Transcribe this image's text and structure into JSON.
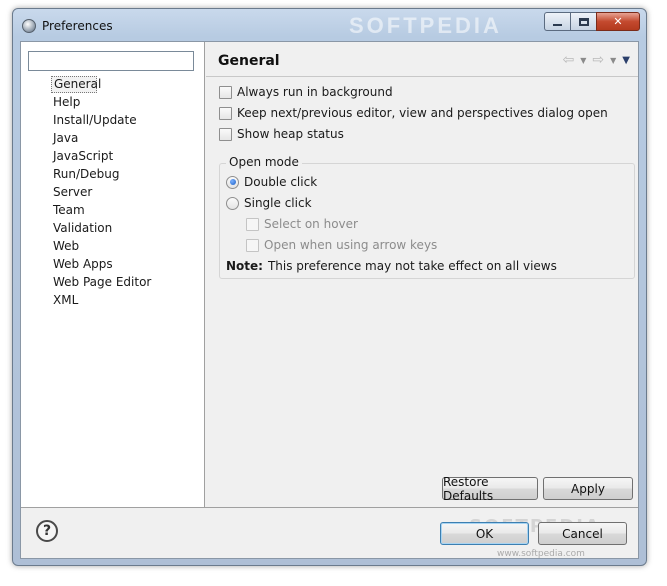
{
  "window": {
    "title": "Preferences",
    "watermark": "SOFTPEDIA"
  },
  "left": {
    "filter_value": "",
    "tree": [
      "General",
      "Help",
      "Install/Update",
      "Java",
      "JavaScript",
      "Run/Debug",
      "Server",
      "Team",
      "Validation",
      "Web",
      "Web Apps",
      "Web Page Editor",
      "XML"
    ]
  },
  "right": {
    "title": "General",
    "options": {
      "always_run": "Always run in background",
      "keep_dialog": "Keep next/previous editor, view and perspectives dialog open",
      "heap": "Show heap status"
    },
    "open_mode": {
      "label": "Open mode",
      "double_click": "Double click",
      "single_click": "Single click",
      "select_hover": "Select on hover",
      "arrow_keys": "Open when using arrow keys",
      "note_label": "Note:",
      "note_text": "This preference may not take effect on all views"
    },
    "restore_defaults": "Restore Defaults",
    "apply": "Apply"
  },
  "footer": {
    "ok": "OK",
    "cancel": "Cancel",
    "watermark": "SOFTPEDIA",
    "watermark_url": "www.softpedia.com"
  },
  "state": {
    "selected_tree_item": "General",
    "open_mode": "Double click",
    "always_run_checked": false,
    "keep_dialog_checked": false,
    "heap_checked": false
  }
}
